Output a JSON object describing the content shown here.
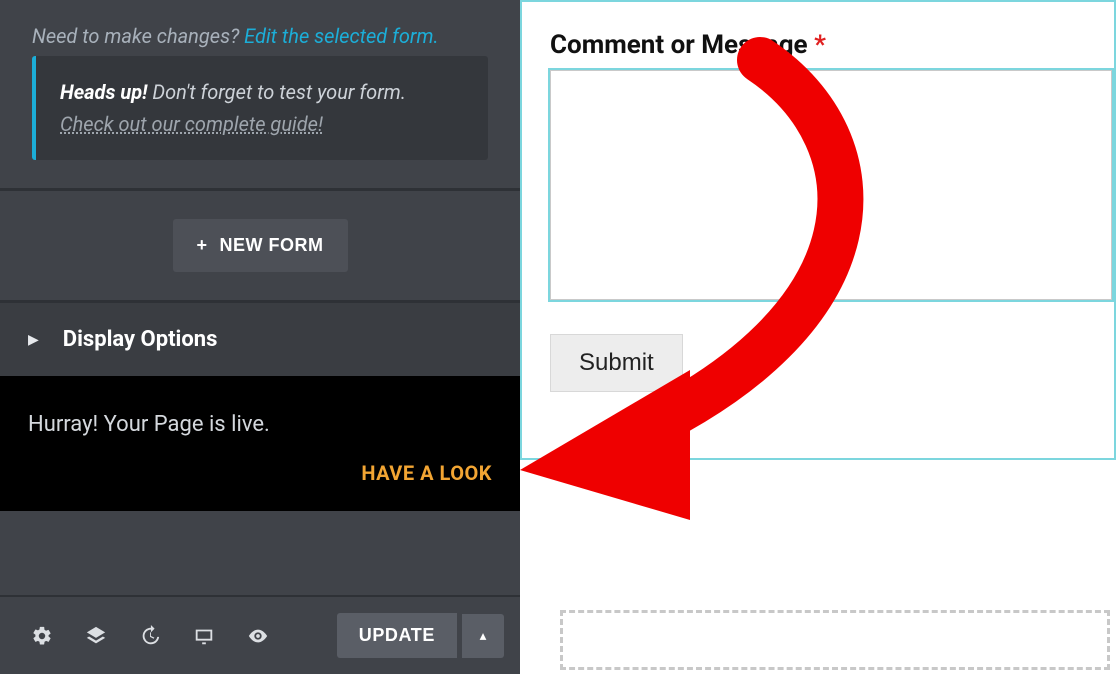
{
  "sidebar": {
    "edit_notice_prefix": "Need to make changes? ",
    "edit_notice_link": "Edit the selected form.",
    "callout": {
      "heads_up": "Heads up!",
      "body": " Don't forget to test your form. ",
      "guide_link": "Check out our complete guide!"
    },
    "new_form_label": "NEW FORM",
    "display_options_label": "Display Options",
    "notification": {
      "message": "Hurray! Your Page is live.",
      "action_label": "HAVE A LOOK"
    },
    "update_label": "UPDATE"
  },
  "icons": {
    "plus": "+",
    "triangle_right": "▶",
    "chevron_left": "‹",
    "caret_up": "▴"
  },
  "preview": {
    "field_label": "Comment or Message ",
    "required_mark": "*",
    "submit_label": "Submit"
  },
  "annotation": {
    "color": "#ef0000"
  }
}
